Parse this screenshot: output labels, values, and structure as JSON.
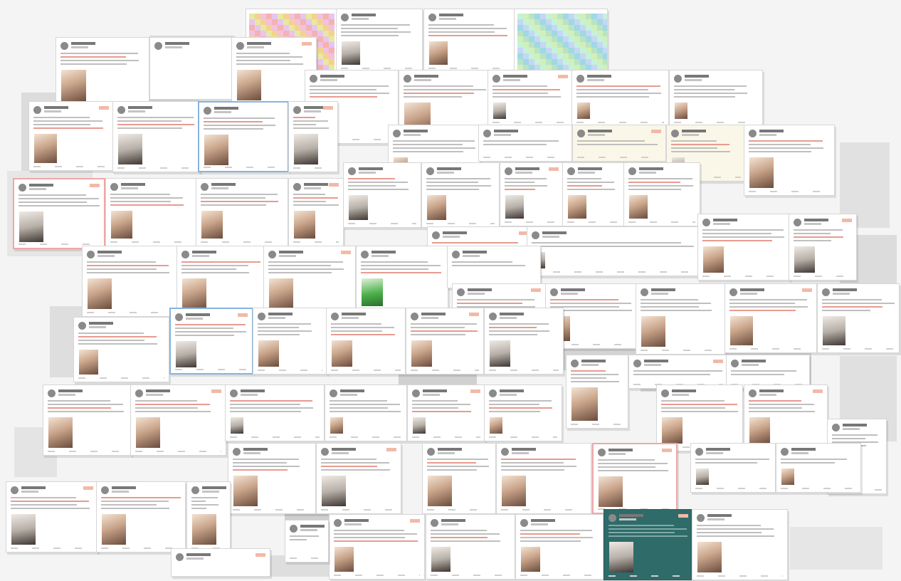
{
  "collage": {
    "palette": {
      "page_background": "#f4f4f4",
      "card_background": "#ffffff",
      "card_border": "#d6d6d6",
      "accent_red": "#e89b8f",
      "accent_teal": "#2f6b69",
      "accent_green": "#4bb04a"
    },
    "card_count": 85,
    "cards": []
  }
}
